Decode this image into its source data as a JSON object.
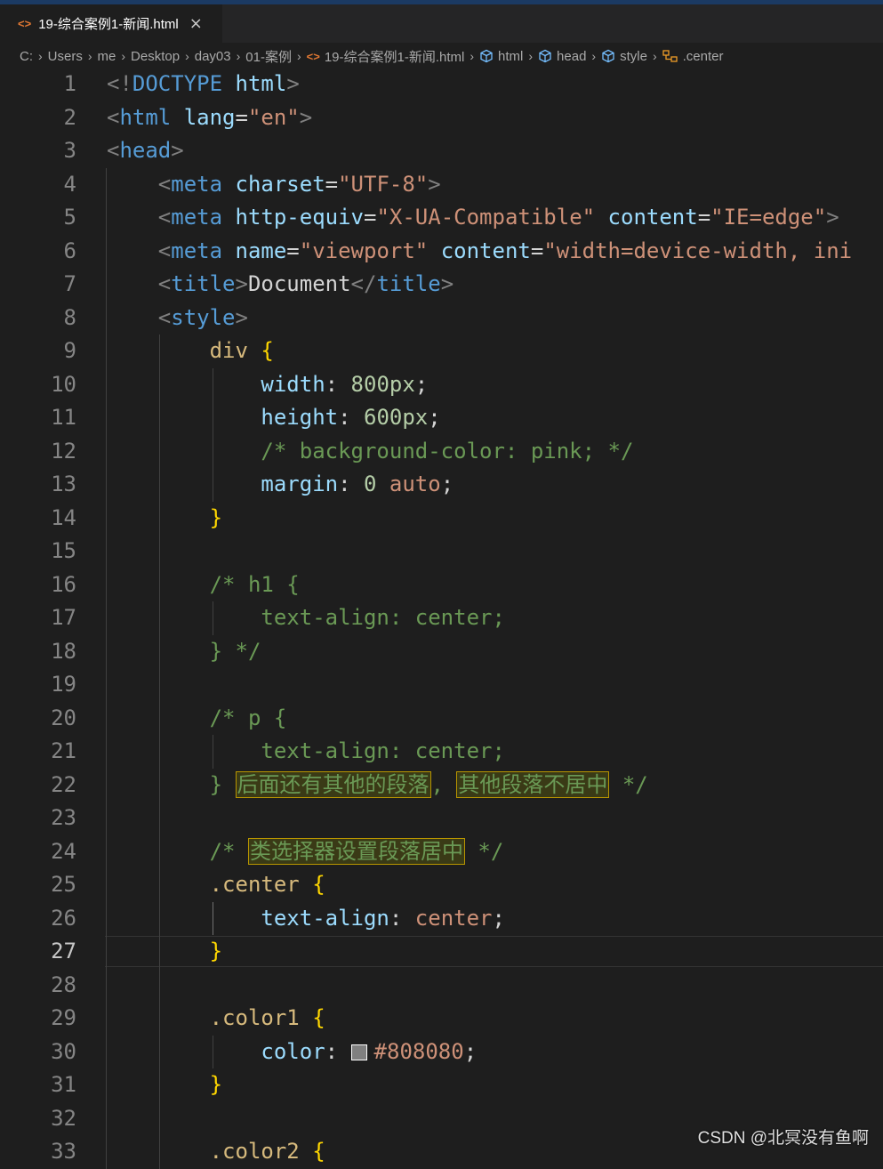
{
  "tab": {
    "icon": "html-file-icon",
    "title": "19-综合案例1-新闻.html",
    "close": "×"
  },
  "breadcrumb": {
    "items": [
      {
        "label": "C:",
        "icon": null
      },
      {
        "label": "Users",
        "icon": null
      },
      {
        "label": "me",
        "icon": null
      },
      {
        "label": "Desktop",
        "icon": null
      },
      {
        "label": "day03",
        "icon": null
      },
      {
        "label": "01-案例",
        "icon": null
      },
      {
        "label": "19-综合案例1-新闻.html",
        "icon": "html-file-icon"
      },
      {
        "label": "html",
        "icon": "element-icon"
      },
      {
        "label": "head",
        "icon": "element-icon"
      },
      {
        "label": "style",
        "icon": "element-icon"
      },
      {
        "label": ".center",
        "icon": "css-selector-icon"
      }
    ],
    "separator": "›"
  },
  "editor": {
    "active_line": 27,
    "lines": [
      {
        "n": "1",
        "tokens": [
          {
            "t": "<!",
            "c": "punct"
          },
          {
            "t": "DOCTYPE",
            "c": "doctype"
          },
          {
            "t": " ",
            "c": "text"
          },
          {
            "t": "html",
            "c": "attr"
          },
          {
            "t": ">",
            "c": "punct"
          }
        ]
      },
      {
        "n": "2",
        "tokens": [
          {
            "t": "<",
            "c": "punct"
          },
          {
            "t": "html",
            "c": "tag"
          },
          {
            "t": " ",
            "c": "text"
          },
          {
            "t": "lang",
            "c": "attr"
          },
          {
            "t": "=",
            "c": "text"
          },
          {
            "t": "\"en\"",
            "c": "str"
          },
          {
            "t": ">",
            "c": "punct"
          }
        ]
      },
      {
        "n": "3",
        "tokens": [
          {
            "t": "<",
            "c": "punct"
          },
          {
            "t": "head",
            "c": "tag"
          },
          {
            "t": ">",
            "c": "punct"
          }
        ]
      },
      {
        "n": "4",
        "tokens": [
          {
            "t": "    ",
            "c": "text"
          },
          {
            "t": "<",
            "c": "punct"
          },
          {
            "t": "meta",
            "c": "tag"
          },
          {
            "t": " ",
            "c": "text"
          },
          {
            "t": "charset",
            "c": "attr"
          },
          {
            "t": "=",
            "c": "text"
          },
          {
            "t": "\"UTF-8\"",
            "c": "str"
          },
          {
            "t": ">",
            "c": "punct"
          }
        ]
      },
      {
        "n": "5",
        "tokens": [
          {
            "t": "    ",
            "c": "text"
          },
          {
            "t": "<",
            "c": "punct"
          },
          {
            "t": "meta",
            "c": "tag"
          },
          {
            "t": " ",
            "c": "text"
          },
          {
            "t": "http-equiv",
            "c": "attr"
          },
          {
            "t": "=",
            "c": "text"
          },
          {
            "t": "\"X-UA-Compatible\"",
            "c": "str"
          },
          {
            "t": " ",
            "c": "text"
          },
          {
            "t": "content",
            "c": "attr"
          },
          {
            "t": "=",
            "c": "text"
          },
          {
            "t": "\"IE=edge\"",
            "c": "str"
          },
          {
            "t": ">",
            "c": "punct"
          }
        ]
      },
      {
        "n": "6",
        "tokens": [
          {
            "t": "    ",
            "c": "text"
          },
          {
            "t": "<",
            "c": "punct"
          },
          {
            "t": "meta",
            "c": "tag"
          },
          {
            "t": " ",
            "c": "text"
          },
          {
            "t": "name",
            "c": "attr"
          },
          {
            "t": "=",
            "c": "text"
          },
          {
            "t": "\"viewport\"",
            "c": "str"
          },
          {
            "t": " ",
            "c": "text"
          },
          {
            "t": "content",
            "c": "attr"
          },
          {
            "t": "=",
            "c": "text"
          },
          {
            "t": "\"width=device-width, ini",
            "c": "str"
          }
        ]
      },
      {
        "n": "7",
        "tokens": [
          {
            "t": "    ",
            "c": "text"
          },
          {
            "t": "<",
            "c": "punct"
          },
          {
            "t": "title",
            "c": "tag"
          },
          {
            "t": ">",
            "c": "punct"
          },
          {
            "t": "Document",
            "c": "text"
          },
          {
            "t": "</",
            "c": "punct"
          },
          {
            "t": "title",
            "c": "tag"
          },
          {
            "t": ">",
            "c": "punct"
          }
        ]
      },
      {
        "n": "8",
        "tokens": [
          {
            "t": "    ",
            "c": "text"
          },
          {
            "t": "<",
            "c": "punct"
          },
          {
            "t": "style",
            "c": "tag"
          },
          {
            "t": ">",
            "c": "punct"
          }
        ]
      },
      {
        "n": "9",
        "tokens": [
          {
            "t": "        ",
            "c": "text"
          },
          {
            "t": "div",
            "c": "sel"
          },
          {
            "t": " ",
            "c": "text"
          },
          {
            "t": "{",
            "c": "brace"
          }
        ]
      },
      {
        "n": "10",
        "tokens": [
          {
            "t": "            ",
            "c": "text"
          },
          {
            "t": "width",
            "c": "prop"
          },
          {
            "t": ": ",
            "c": "text"
          },
          {
            "t": "800px",
            "c": "num"
          },
          {
            "t": ";",
            "c": "text"
          }
        ]
      },
      {
        "n": "11",
        "tokens": [
          {
            "t": "            ",
            "c": "text"
          },
          {
            "t": "height",
            "c": "prop"
          },
          {
            "t": ": ",
            "c": "text"
          },
          {
            "t": "600px",
            "c": "num"
          },
          {
            "t": ";",
            "c": "text"
          }
        ]
      },
      {
        "n": "12",
        "tokens": [
          {
            "t": "            ",
            "c": "text"
          },
          {
            "t": "/* background-color: pink; */",
            "c": "comment"
          }
        ]
      },
      {
        "n": "13",
        "tokens": [
          {
            "t": "            ",
            "c": "text"
          },
          {
            "t": "margin",
            "c": "prop"
          },
          {
            "t": ": ",
            "c": "text"
          },
          {
            "t": "0",
            "c": "num"
          },
          {
            "t": " ",
            "c": "text"
          },
          {
            "t": "auto",
            "c": "val"
          },
          {
            "t": ";",
            "c": "text"
          }
        ]
      },
      {
        "n": "14",
        "tokens": [
          {
            "t": "        ",
            "c": "text"
          },
          {
            "t": "}",
            "c": "brace"
          }
        ]
      },
      {
        "n": "15",
        "tokens": []
      },
      {
        "n": "16",
        "tokens": [
          {
            "t": "        ",
            "c": "text"
          },
          {
            "t": "/* h1 {",
            "c": "comment"
          }
        ]
      },
      {
        "n": "17",
        "tokens": [
          {
            "t": "            ",
            "c": "text"
          },
          {
            "t": "text-align: center;",
            "c": "comment"
          }
        ]
      },
      {
        "n": "18",
        "tokens": [
          {
            "t": "        ",
            "c": "text"
          },
          {
            "t": "} */",
            "c": "comment"
          }
        ]
      },
      {
        "n": "19",
        "tokens": []
      },
      {
        "n": "20",
        "tokens": [
          {
            "t": "        ",
            "c": "text"
          },
          {
            "t": "/* p {",
            "c": "comment"
          }
        ]
      },
      {
        "n": "21",
        "tokens": [
          {
            "t": "            ",
            "c": "text"
          },
          {
            "t": "text-align: center;",
            "c": "comment"
          }
        ]
      },
      {
        "n": "22",
        "tokens": [
          {
            "t": "        ",
            "c": "text"
          },
          {
            "t": "} ",
            "c": "comment"
          },
          {
            "t": "后面还有其他的段落",
            "c": "cjk"
          },
          {
            "t": ", ",
            "c": "comment"
          },
          {
            "t": "其他段落不居中",
            "c": "cjk"
          },
          {
            "t": " */",
            "c": "comment"
          }
        ]
      },
      {
        "n": "23",
        "tokens": []
      },
      {
        "n": "24",
        "tokens": [
          {
            "t": "        ",
            "c": "text"
          },
          {
            "t": "/* ",
            "c": "comment"
          },
          {
            "t": "类选择器设置段落居中",
            "c": "cjk"
          },
          {
            "t": " */",
            "c": "comment"
          }
        ]
      },
      {
        "n": "25",
        "tokens": [
          {
            "t": "        ",
            "c": "text"
          },
          {
            "t": ".center",
            "c": "sel"
          },
          {
            "t": " ",
            "c": "text"
          },
          {
            "t": "{",
            "c": "brace"
          }
        ]
      },
      {
        "n": "26",
        "tokens": [
          {
            "t": "            ",
            "c": "text"
          },
          {
            "t": "text-align",
            "c": "prop"
          },
          {
            "t": ": ",
            "c": "text"
          },
          {
            "t": "center",
            "c": "val"
          },
          {
            "t": ";",
            "c": "text"
          }
        ]
      },
      {
        "n": "27",
        "tokens": [
          {
            "t": "        ",
            "c": "text"
          },
          {
            "t": "}",
            "c": "brace"
          }
        ]
      },
      {
        "n": "28",
        "tokens": []
      },
      {
        "n": "29",
        "tokens": [
          {
            "t": "        ",
            "c": "text"
          },
          {
            "t": ".color1",
            "c": "sel"
          },
          {
            "t": " ",
            "c": "text"
          },
          {
            "t": "{",
            "c": "brace"
          }
        ]
      },
      {
        "n": "30",
        "tokens": [
          {
            "t": "            ",
            "c": "text"
          },
          {
            "t": "color",
            "c": "prop"
          },
          {
            "t": ": ",
            "c": "text"
          },
          {
            "t": "",
            "c": "swatch",
            "color": "#808080"
          },
          {
            "t": "#808080",
            "c": "val"
          },
          {
            "t": ";",
            "c": "text"
          }
        ]
      },
      {
        "n": "31",
        "tokens": [
          {
            "t": "        ",
            "c": "text"
          },
          {
            "t": "}",
            "c": "brace"
          }
        ]
      },
      {
        "n": "32",
        "tokens": []
      },
      {
        "n": "33",
        "tokens": [
          {
            "t": "        ",
            "c": "text"
          },
          {
            "t": ".color2",
            "c": "sel"
          },
          {
            "t": " ",
            "c": "text"
          },
          {
            "t": "{",
            "c": "brace"
          }
        ]
      }
    ]
  },
  "watermark": "CSDN @北冥没有鱼啊",
  "colors": {
    "background": "#1e1e1e",
    "tag": "#569cd6",
    "attribute": "#9cdcfe",
    "string": "#ce9178",
    "selector": "#d7ba7d",
    "brace": "#ffd700",
    "number": "#b5cea8",
    "comment": "#6a9955"
  }
}
